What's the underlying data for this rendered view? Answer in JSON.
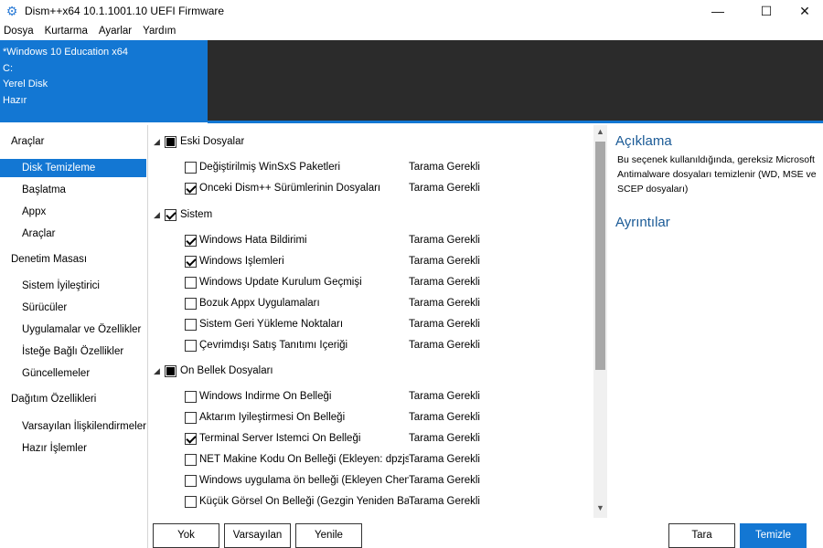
{
  "window": {
    "title": "Dism++x64 10.1.1001.10 UEFI Firmware",
    "icon": "gear-icon",
    "controls": {
      "minimize": "—",
      "maximize": "☐",
      "close": "✕"
    }
  },
  "menu": [
    "Dosya",
    "Kurtarma",
    "Ayarlar",
    "Yardım"
  ],
  "system": {
    "name": "*Windows 10 Education x64",
    "drive": "C:",
    "disk": "Yerel Disk",
    "state": "Hazır"
  },
  "sidebar": {
    "groups": [
      {
        "label": "Araçlar",
        "items": [
          "Disk Temizleme",
          "Başlatma",
          "Appx",
          "Araçlar"
        ]
      },
      {
        "label": "Denetim Masası",
        "items": [
          "Sistem İyileştirici",
          "Sürücüler",
          "Uygulamalar ve Özellikler",
          "İsteğe Bağlı Özellikler",
          "Güncellemeler"
        ]
      },
      {
        "label": "Dağıtım Özellikleri",
        "items": [
          "Varsayılan İlişkilendirmeler",
          "Hazır İşlemler"
        ]
      }
    ],
    "selected": "Disk Temizleme"
  },
  "cleanup": {
    "categories": [
      {
        "label": "Eski Dosyalar",
        "state": "indeterminate",
        "items": [
          {
            "label": "Değiştirilmiş WinSxS Paketleri",
            "checked": false,
            "status": "Tarama Gerekli"
          },
          {
            "label": "Önceki Dism++ Sürümlerinin Dosyaları",
            "checked": true,
            "status": "Tarama Gerekli"
          }
        ]
      },
      {
        "label": "Sistem",
        "state": "checked",
        "items": [
          {
            "label": "Windows Hata Bildirimi",
            "checked": true,
            "status": "Tarama Gerekli"
          },
          {
            "label": "Windows İşlemleri",
            "checked": true,
            "status": "Tarama Gerekli"
          },
          {
            "label": "Windows Update Kurulum Geçmişi",
            "checked": false,
            "status": "Tarama Gerekli"
          },
          {
            "label": "Bozuk Appx Uygulamaları",
            "checked": false,
            "status": "Tarama Gerekli"
          },
          {
            "label": "Sistem Geri Yükleme Noktaları",
            "checked": false,
            "status": "Tarama Gerekli"
          },
          {
            "label": "Çevrimdışı Satış Tanıtımı İçeriği",
            "checked": false,
            "status": "Tarama Gerekli"
          }
        ]
      },
      {
        "label": "Ön Bellek Dosyaları",
        "state": "indeterminate",
        "items": [
          {
            "label": "Windows İndirme Ön Belleği",
            "checked": false,
            "status": "Tarama Gerekli"
          },
          {
            "label": "Aktarım İyileştirmesi Ön Belleği",
            "checked": false,
            "status": "Tarama Gerekli"
          },
          {
            "label": "Terminal Server İstemci Ön Belleği",
            "checked": true,
            "status": "Tarama Gerekli"
          },
          {
            "label": "NET Makine Kodu Ön Belleği (Ekleyen: dpzjsy)",
            "checked": false,
            "status": "Tarama Gerekli"
          },
          {
            "label": "Windows uygulama ön belleği (Ekleyen Cheng :",
            "checked": false,
            "status": "Tarama Gerekli"
          },
          {
            "label": "Küçük Görsel Ön Belleği (Gezgin Yeniden Başlatı",
            "checked": false,
            "status": "Tarama Gerekli"
          }
        ]
      }
    ]
  },
  "description": {
    "heading": "Açıklama",
    "text": "Bu seçenek kullanıldığında, gereksiz Microsoft Antimalware  dosyaları temizlenir (WD, MSE ve SCEP dosyaları)",
    "details_heading": "Ayrıntılar"
  },
  "buttons": {
    "none": "Yok",
    "defaults": "Varsayılan",
    "refresh": "Yenile",
    "scan": "Tara",
    "clean": "Temizle"
  },
  "colors": {
    "accent": "#1377d3",
    "header_dark": "#2b2b2b",
    "heading": "#1a5a96"
  }
}
